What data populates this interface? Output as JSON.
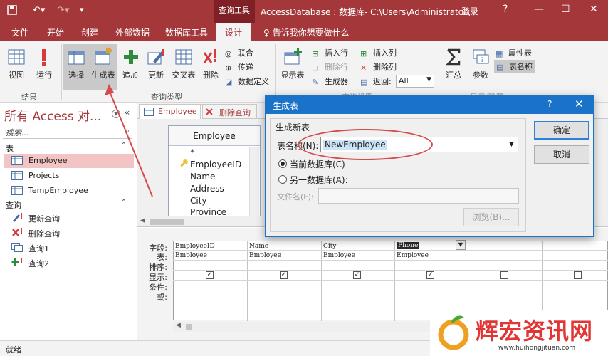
{
  "titlebar": {
    "context_tab": "查询工具",
    "title": "AccessDatabase : 数据库- C:\\Users\\Administrator\\...",
    "login": "登录",
    "help_glyph": "?",
    "minimize_glyph": "—",
    "restore_glyph": "☐",
    "close_glyph": "✕"
  },
  "tabs": {
    "file": "文件",
    "home": "开始",
    "create": "创建",
    "external": "外部数据",
    "dbtools": "数据库工具",
    "design": "设计",
    "tell": "♀ 告诉我你想要做什么"
  },
  "ribbon": {
    "results": {
      "view": "视图",
      "run": "运行",
      "group": "结果"
    },
    "querytype": {
      "select": "选择",
      "make_table": "生成表",
      "append": "追加",
      "update": "更新",
      "crosstab": "交叉表",
      "delete": "删除",
      "union": "联合",
      "passthrough": "传递",
      "data_def": "数据定义",
      "group": "查询类型"
    },
    "setup": {
      "show_table": "显示表",
      "insert_row": "插入行",
      "delete_row": "删除行",
      "builder": "生成器",
      "insert_col": "插入列",
      "delete_col": "删除列",
      "return_label": "返回:",
      "return_value": "All",
      "group": "查询设置"
    },
    "showhide": {
      "totals": "汇总",
      "params": "参数",
      "property": "属性表",
      "table_names": "表名称",
      "group": "显示/隐藏"
    }
  },
  "nav": {
    "title": "所有 Access 对...",
    "search_placeholder": "搜索...",
    "sections": [
      {
        "label": "表",
        "items": [
          "Employee",
          "Projects",
          "TempEmployee"
        ]
      },
      {
        "label": "查询",
        "items": [
          "更新查询",
          "删除查询",
          "查询1",
          "查询2"
        ]
      }
    ]
  },
  "doctabs": {
    "tab1": "Employee",
    "tab2": "删除查询"
  },
  "table_box": {
    "title": "Employee",
    "fields": [
      "*",
      "EmployeeID",
      "Name",
      "Address",
      "City",
      "Province"
    ]
  },
  "qbe": {
    "row_labels": [
      "字段:",
      "表:",
      "排序:",
      "显示:",
      "条件:",
      "或:"
    ],
    "columns": [
      {
        "field": "EmployeeID",
        "table": "Employee",
        "show": true
      },
      {
        "field": "Name",
        "table": "Employee",
        "show": true
      },
      {
        "field": "City",
        "table": "Employee",
        "show": true
      },
      {
        "field": "Phone",
        "table": "Employee",
        "show": true
      },
      {
        "field": "",
        "table": "",
        "show": false
      },
      {
        "field": "",
        "table": "",
        "show": false
      }
    ]
  },
  "dialog": {
    "title": "生成表",
    "section": "生成新表",
    "table_name_label": "表名称(N):",
    "table_name_value": "NewEmployee",
    "current_db": "当前数据库(C)",
    "other_db": "另一数据库(A):",
    "file_name_label": "文件名(F):",
    "browse": "浏览(B)...",
    "ok": "确定",
    "cancel": "取消",
    "help_glyph": "?",
    "close_glyph": "✕"
  },
  "status": {
    "text": "就绪"
  },
  "watermark": {
    "name": "辉宏资讯网",
    "url": "www.huihongjituan.com"
  },
  "colors": {
    "accent": "#a4373a",
    "dialog_blue": "#1a73c8",
    "annotation": "#d64a4a"
  }
}
